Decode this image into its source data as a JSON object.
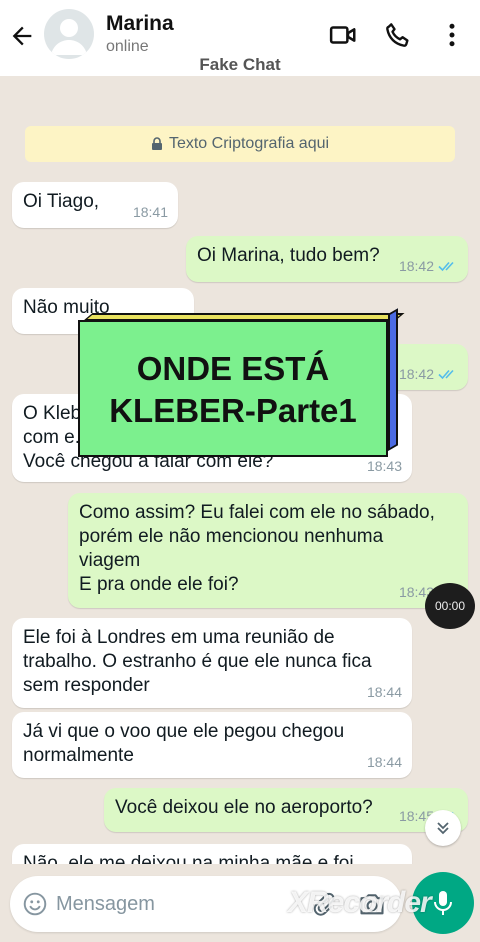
{
  "header": {
    "contact_name": "Marina",
    "status": "online",
    "caption": "Fake Chat"
  },
  "chat": {
    "encryption_notice": "Texto Criptografia aqui",
    "messages": [
      {
        "dir": "in",
        "text": "Oi Tiago,",
        "time": "18:41"
      },
      {
        "dir": "out",
        "text": "Oi Marina, tudo bem?",
        "time": "18:42",
        "read": true
      },
      {
        "dir": "in",
        "text": "Não muito",
        "time": "18:42"
      },
      {
        "dir": "out",
        "text": "",
        "time": "18:42",
        "read": true
      },
      {
        "dir": "in",
        "text": "O Kleber ...\ncom e...\nVocê chegou a falar com ele?",
        "time": "18:43"
      },
      {
        "dir": "out",
        "text": "Como assim? Eu falei com ele no sábado,\nporém ele não mencionou nenhuma\nviagem\nE pra onde ele foi?",
        "time": "18:43",
        "read": true
      },
      {
        "dir": "in",
        "text": "Ele foi à Londres em uma reunião de\ntrabalho. O estranho é que ele nunca fica\nsem responder",
        "time": "18:44"
      },
      {
        "dir": "in",
        "text": "Já vi que o voo que ele pegou chegou\nnormalmente",
        "time": "18:44"
      },
      {
        "dir": "out",
        "text": "Você deixou ele no aeroporto?",
        "time": "18:45",
        "read": true
      },
      {
        "dir": "in",
        "text": "Não, ele me deixou na minha mãe e foi",
        "time": ""
      }
    ]
  },
  "overlay": {
    "title_line1": "ONDE ESTÁ",
    "title_line2": "KLEBER-Parte1",
    "timer": "00:00"
  },
  "composer": {
    "placeholder": "Mensagem"
  },
  "watermark": "XRecorder",
  "colors": {
    "outgoing_bubble": "#dcf8c6",
    "incoming_bubble": "#ffffff",
    "read_ticks": "#53bdeb",
    "accent": "#00a884",
    "title_card": "#7cf08e"
  }
}
